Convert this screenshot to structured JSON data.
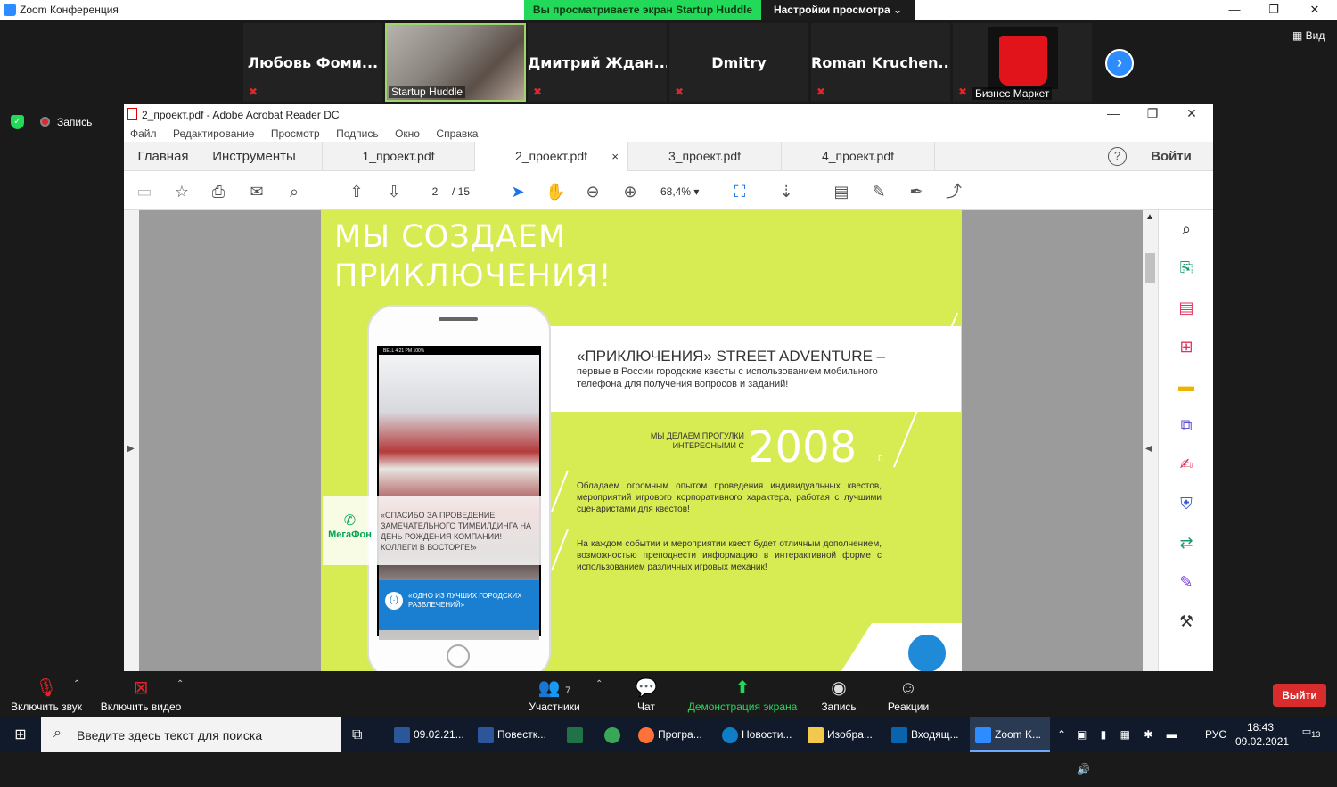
{
  "zoom": {
    "window_title": "Zoom Конференция",
    "share_banner": "Вы просматриваете экран Startup Huddle",
    "view_settings": "Настройки просмотра ⌄",
    "view_label": "Вид",
    "record_label": "Запись",
    "participants": [
      {
        "name": "Любовь Фоми..."
      },
      {
        "name": "Startup Huddle"
      },
      {
        "name": "Дмитрий Ждан..."
      },
      {
        "name": "Dmitry"
      },
      {
        "name": "Roman Kruchen..."
      },
      {
        "name": "Бизнес Маркет"
      }
    ],
    "bottom_bar": {
      "mute": "Включить звук",
      "video": "Включить видео",
      "participants": "Участники",
      "participants_count": "7",
      "chat": "Чат",
      "share": "Демонстрация экрана",
      "record": "Запись",
      "reactions": "Реакции",
      "leave": "Выйти"
    }
  },
  "acrobat": {
    "title": "2_проект.pdf - Adobe Acrobat Reader DC",
    "menu": [
      "Файл",
      "Редактирование",
      "Просмотр",
      "Подпись",
      "Окно",
      "Справка"
    ],
    "nav_tabs": [
      "Главная",
      "Инструменты"
    ],
    "doc_tabs": [
      "1_проект.pdf",
      "2_проект.pdf",
      "3_проект.pdf",
      "4_проект.pdf"
    ],
    "active_tab": "2_проект.pdf",
    "close_x": "×",
    "help": "?",
    "signin": "Войти",
    "page_current": "2",
    "page_total": "/ 15",
    "zoom_level": "68,4%"
  },
  "pdf": {
    "headline_1": "МЫ СОЗДАЕМ",
    "headline_2": "ПРИКЛЮЧЕНИЯ!",
    "sa_title": "«ПРИКЛЮЧЕНИЯ» STREET ADVENTURE –",
    "sa_sub": "первые в России городские квесты с использованием мобильного телефона для получения вопросов и заданий!",
    "since_text": "МЫ ДЕЛАЕМ ПРОГУЛКИ ИНТЕРЕСНЫМИ С",
    "year": "2008",
    "year_suffix": "г.",
    "para_1": "Обладаем огромным опытом проведения индивидуальных квестов, мероприятий игрового корпоративного характера, работая с лучшими сценаристами для квестов!",
    "para_2": "На каждом событии и мероприятии квест будет отличным дополнением, возможностью преподнести информацию в интерактивной форме с использованием различных игровых механик!",
    "quote": "«СПАСИБО ЗА ПРОВЕДЕНИЕ ЗАМЕЧАТЕЛЬНОГО ТИМБИЛДИНГА НА ДЕНЬ РОЖДЕНИЯ КОМПАНИИ! КОЛЛЕГИ В ВОСТОРГЕ!»",
    "megafon": "МегаФон",
    "blue_quote": "«ОДНО ИЗ ЛУЧШИХ ГОРОДСКИХ РАЗВЛЕЧЕНИЙ»",
    "phone_status": "BELL   4:21 PM   100%"
  },
  "taskbar": {
    "search_placeholder": "Введите здесь текст для поиска",
    "apps": [
      "09.02.21...",
      "Повестк...",
      "Програ...",
      "Новости...",
      "Изобра...",
      "Входящ...",
      "Zoom K..."
    ],
    "lang": "РУС",
    "time": "18:43",
    "date": "09.02.2021",
    "notifications": "13"
  },
  "colors": {
    "zoom_green": "#23d959",
    "zoom_blue": "#2d8cff",
    "pdf_lime": "#d7eb52",
    "leave_red": "#d92d2d"
  }
}
